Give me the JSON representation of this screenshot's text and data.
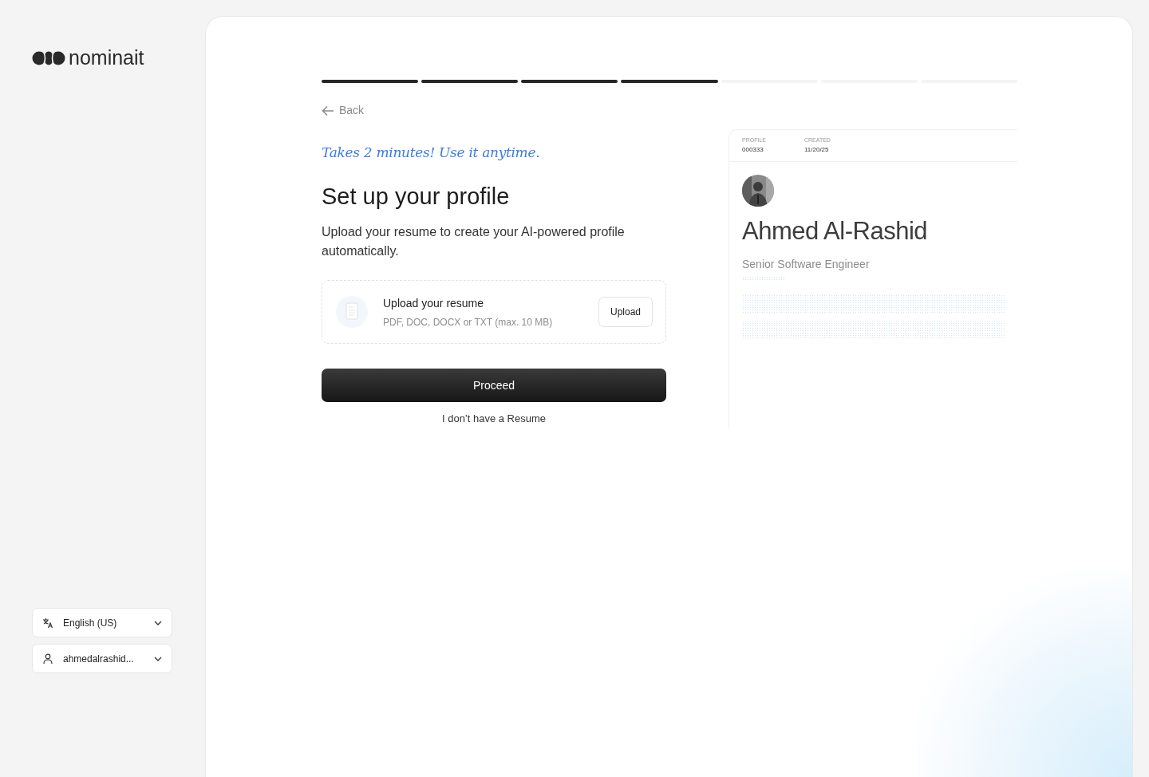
{
  "brand": {
    "name": "nominait"
  },
  "sidebar": {
    "selectors": [
      {
        "kind": "language",
        "label": "English (US)"
      },
      {
        "kind": "account",
        "label": "ahmedalrashid..."
      }
    ]
  },
  "progress": {
    "steps": [
      {
        "done": true
      },
      {
        "done": true
      },
      {
        "done": true
      },
      {
        "done": true
      },
      {
        "done": false
      },
      {
        "done": false
      },
      {
        "done": false
      }
    ]
  },
  "back": {
    "label": "Back"
  },
  "tagline": "Takes 2 minutes! Use it anytime.",
  "title": "Set up your profile",
  "description": "Upload your resume to create your AI-powered profile automatically.",
  "upload": {
    "title": "Upload your resume",
    "hint": "PDF, DOC, DOCX or TXT (max. 10 MB)",
    "button": "Upload"
  },
  "proceed": "Proceed",
  "no_resume": "I don’t have a Resume",
  "preview": {
    "fields": [
      {
        "label": "PROFILE",
        "value": "000333"
      },
      {
        "label": "CREATED",
        "value": "11/20/25"
      }
    ],
    "name": "Ahmed Al-Rashid",
    "role": "Senior Software Engineer"
  }
}
